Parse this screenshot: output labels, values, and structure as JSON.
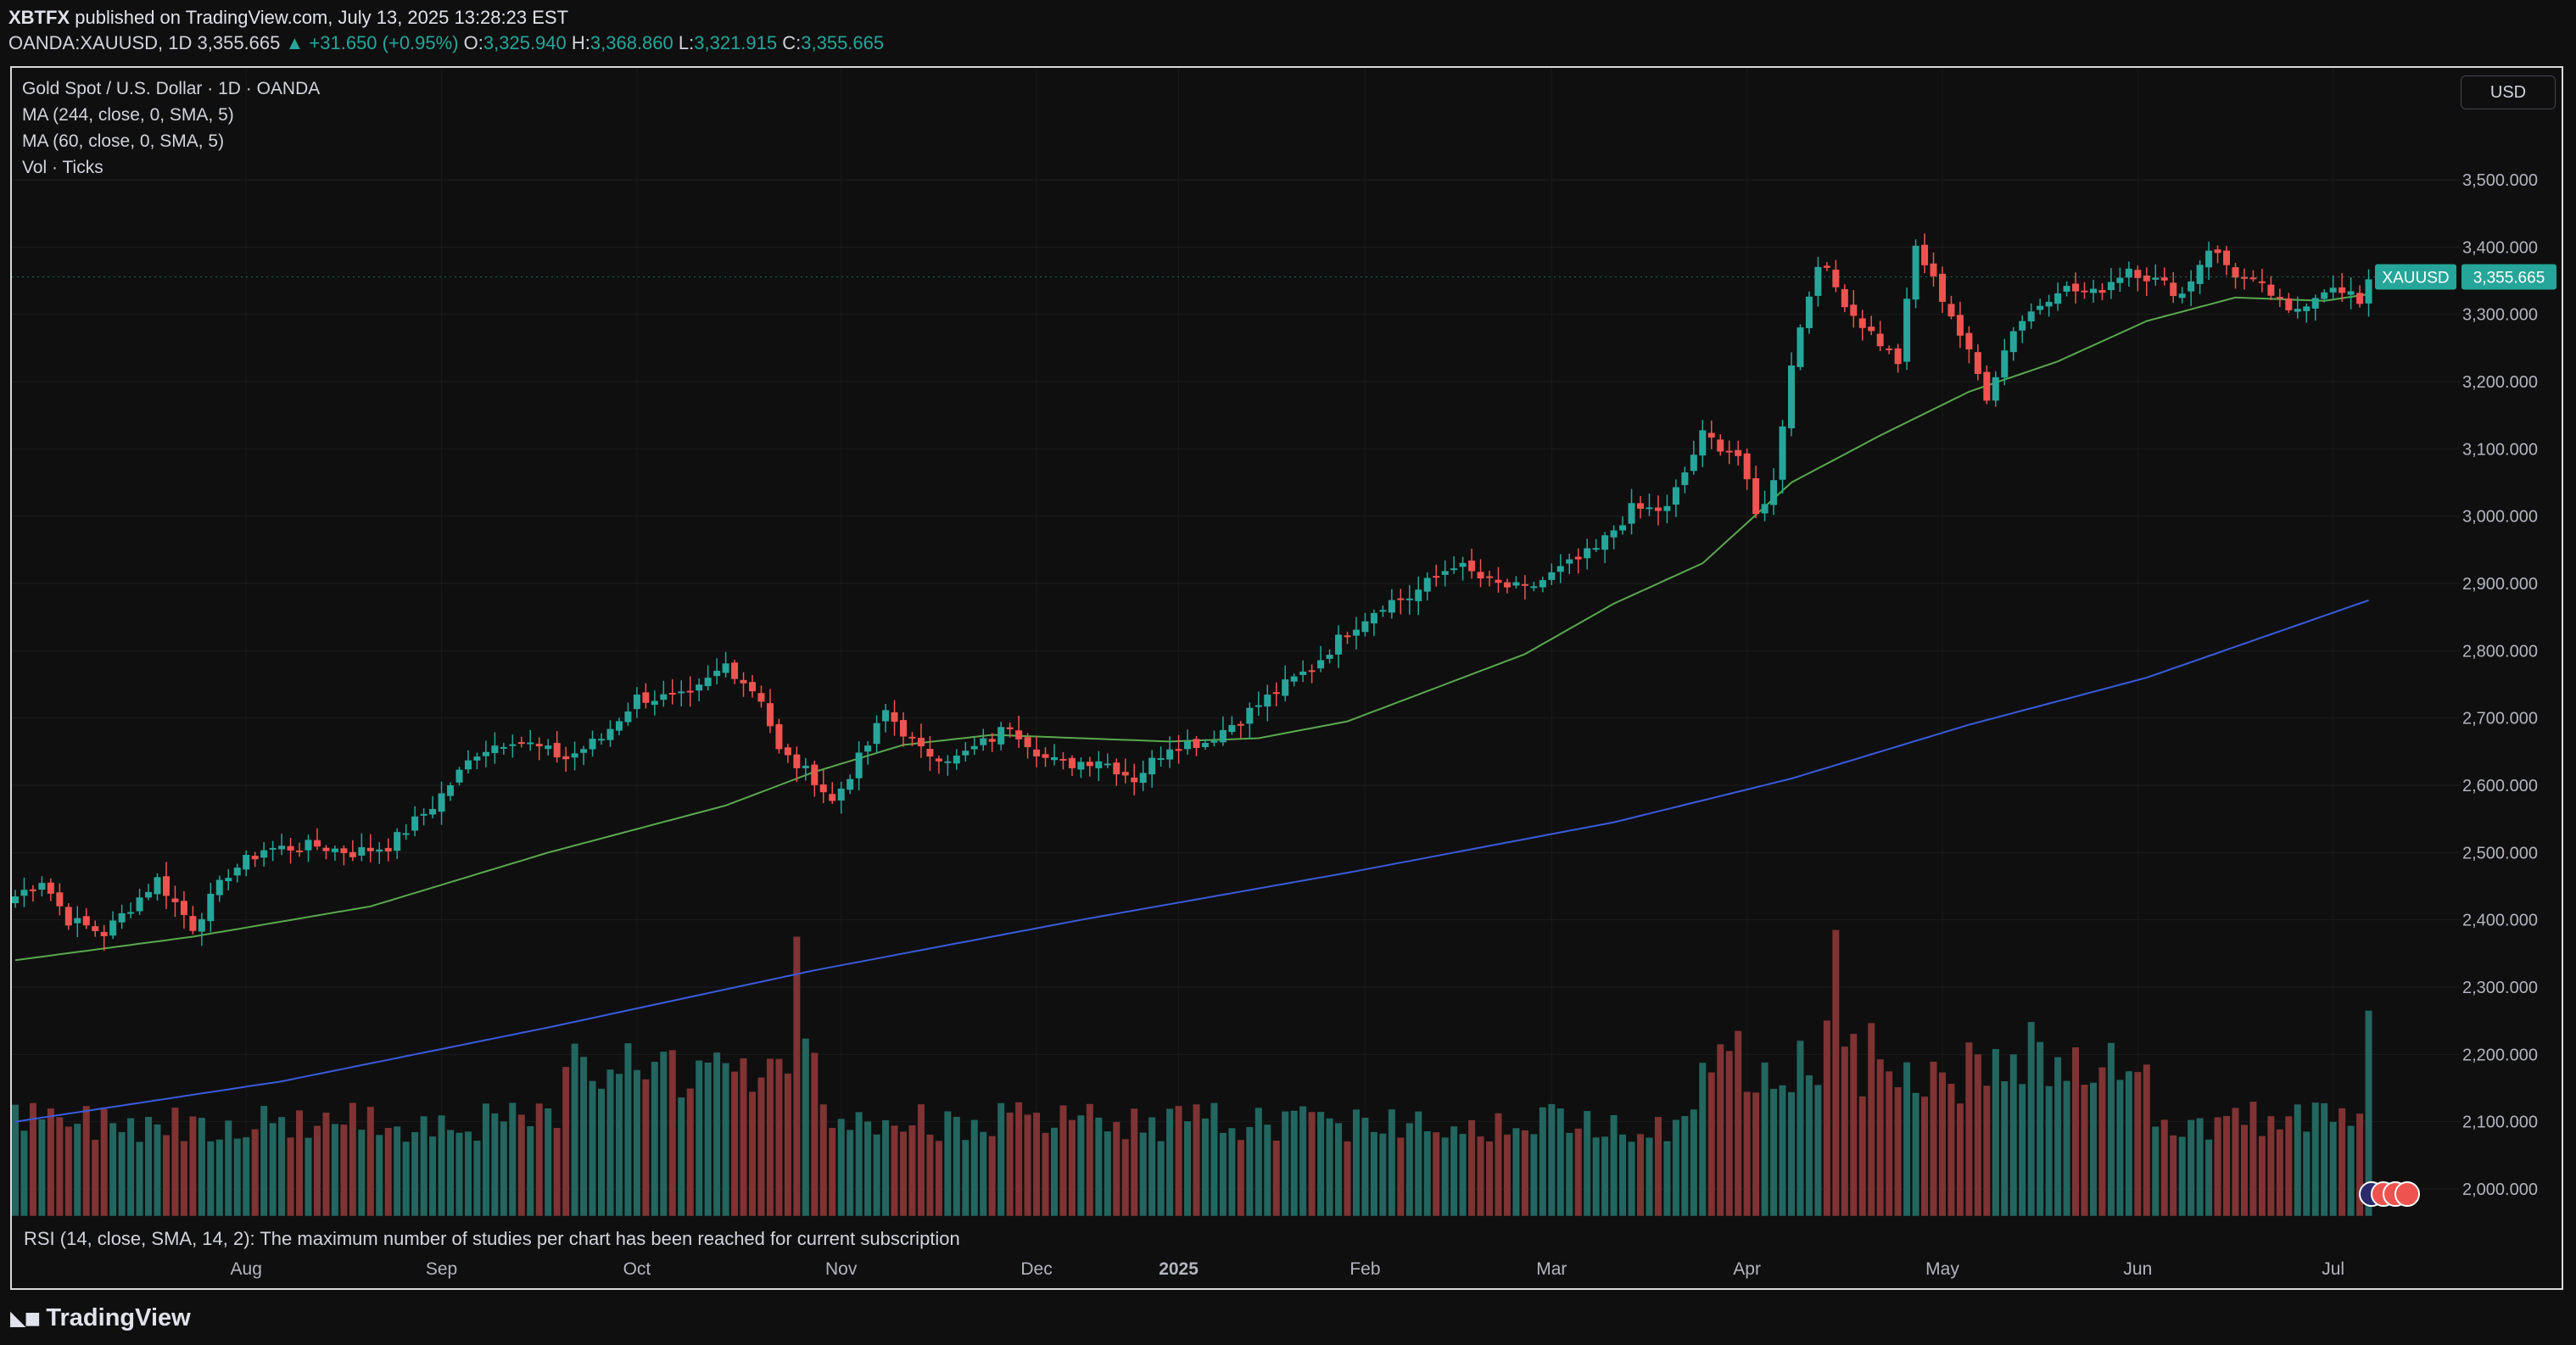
{
  "header": {
    "author": "XBTFX",
    "published_text": "published on TradingView.com, July 13, 2025 13:28:23 EST",
    "symbol_line": "OANDA:XAUUSD, 1D",
    "last": "3,355.665",
    "change": "▲ +31.650 (+0.95%)",
    "o_label": "O:",
    "o_value": "3,325.940",
    "h_label": "H:",
    "h_value": "3,368.860",
    "l_label": "L:",
    "l_value": "3,321.915",
    "c_label": "C:",
    "c_value": "3,355.665"
  },
  "legend": {
    "title": "Gold Spot / U.S. Dollar · 1D · OANDA",
    "ma244": "MA (244, close, 0, SMA, 5)",
    "ma60": "MA (60, close, 0, SMA, 5)",
    "vol": "Vol · Ticks"
  },
  "currency_button": "USD",
  "rsi_message": "RSI (14, close, SMA, 14, 2): The maximum number of studies per chart has been reached for current subscription",
  "brand": "TradingView",
  "colors": {
    "up": "#26a69a",
    "down": "#ef5350",
    "vol_up": "#22665f",
    "vol_down": "#7f3333",
    "ma60": "#5aa84f",
    "ma244": "#3b5bdb",
    "background": "#0f0f0f"
  },
  "chart_data": {
    "type": "candlestick",
    "symbol": "XAUUSD",
    "last_price_label": "3,355.665",
    "y_ticks": [
      "3,500.000",
      "3,400.000",
      "3,300.000",
      "3,200.000",
      "3,100.000",
      "3,000.000",
      "2,900.000",
      "2,800.000",
      "2,700.000",
      "2,600.000",
      "2,500.000",
      "2,400.000",
      "2,300.000",
      "2,200.000",
      "2,100.000",
      "2,000.000"
    ],
    "y_tick_values": [
      3500,
      3400,
      3300,
      3200,
      3100,
      3000,
      2900,
      2800,
      2700,
      2600,
      2500,
      2400,
      2300,
      2200,
      2100,
      2000
    ],
    "x_ticks": [
      "Aug",
      "Sep",
      "Oct",
      "Nov",
      "Dec",
      "2025",
      "Feb",
      "Mar",
      "Apr",
      "May",
      "Jun",
      "Jul"
    ],
    "x_tick_bar_index": [
      26,
      48,
      70,
      93,
      115,
      131,
      152,
      173,
      195,
      217,
      239,
      261
    ],
    "ylim": [
      1960,
      3580
    ],
    "close_anchors": [
      [
        0,
        2435
      ],
      [
        3,
        2460
      ],
      [
        6,
        2400
      ],
      [
        10,
        2380
      ],
      [
        16,
        2460
      ],
      [
        20,
        2390
      ],
      [
        24,
        2470
      ],
      [
        28,
        2505
      ],
      [
        34,
        2510
      ],
      [
        38,
        2500
      ],
      [
        42,
        2510
      ],
      [
        47,
        2570
      ],
      [
        52,
        2650
      ],
      [
        56,
        2670
      ],
      [
        62,
        2640
      ],
      [
        66,
        2670
      ],
      [
        70,
        2730
      ],
      [
        76,
        2730
      ],
      [
        80,
        2780
      ],
      [
        84,
        2730
      ],
      [
        86,
        2650
      ],
      [
        90,
        2610
      ],
      [
        92,
        2575
      ],
      [
        96,
        2660
      ],
      [
        98,
        2710
      ],
      [
        102,
        2650
      ],
      [
        106,
        2640
      ],
      [
        110,
        2670
      ],
      [
        112,
        2690
      ],
      [
        116,
        2640
      ],
      [
        118,
        2630
      ],
      [
        122,
        2640
      ],
      [
        126,
        2610
      ],
      [
        130,
        2660
      ],
      [
        134,
        2665
      ],
      [
        138,
        2700
      ],
      [
        142,
        2740
      ],
      [
        146,
        2775
      ],
      [
        150,
        2830
      ],
      [
        154,
        2870
      ],
      [
        157,
        2880
      ],
      [
        162,
        2930
      ],
      [
        166,
        2900
      ],
      [
        170,
        2890
      ],
      [
        174,
        2920
      ],
      [
        178,
        2950
      ],
      [
        182,
        3010
      ],
      [
        186,
        3010
      ],
      [
        190,
        3120
      ],
      [
        194,
        3090
      ],
      [
        196,
        3000
      ],
      [
        198,
        3050
      ],
      [
        200,
        3230
      ],
      [
        203,
        3380
      ],
      [
        207,
        3300
      ],
      [
        212,
        3230
      ],
      [
        214,
        3400
      ],
      [
        218,
        3300
      ],
      [
        222,
        3180
      ],
      [
        225,
        3280
      ],
      [
        230,
        3340
      ],
      [
        234,
        3330
      ],
      [
        238,
        3370
      ],
      [
        244,
        3330
      ],
      [
        247,
        3400
      ],
      [
        250,
        3360
      ],
      [
        254,
        3330
      ],
      [
        256,
        3300
      ],
      [
        260,
        3340
      ],
      [
        264,
        3320
      ],
      [
        265,
        3355
      ]
    ],
    "ma60": [
      [
        0,
        2340
      ],
      [
        20,
        2375
      ],
      [
        40,
        2420
      ],
      [
        60,
        2500
      ],
      [
        80,
        2570
      ],
      [
        90,
        2620
      ],
      [
        100,
        2660
      ],
      [
        110,
        2675
      ],
      [
        120,
        2670
      ],
      [
        130,
        2665
      ],
      [
        140,
        2670
      ],
      [
        150,
        2695
      ],
      [
        160,
        2745
      ],
      [
        170,
        2795
      ],
      [
        180,
        2870
      ],
      [
        190,
        2930
      ],
      [
        200,
        3050
      ],
      [
        210,
        3120
      ],
      [
        220,
        3185
      ],
      [
        230,
        3230
      ],
      [
        240,
        3290
      ],
      [
        250,
        3325
      ],
      [
        260,
        3320
      ],
      [
        265,
        3330
      ]
    ],
    "ma244": [
      [
        0,
        2100
      ],
      [
        30,
        2160
      ],
      [
        60,
        2240
      ],
      [
        90,
        2325
      ],
      [
        120,
        2400
      ],
      [
        150,
        2470
      ],
      [
        180,
        2545
      ],
      [
        200,
        2610
      ],
      [
        220,
        2690
      ],
      [
        240,
        2760
      ],
      [
        265,
        2875
      ]
    ],
    "volume_axis_max": 2380,
    "volume_baseline": 1960,
    "volume_note": "volume bars drawn behind price on same scale, heights estimated"
  }
}
